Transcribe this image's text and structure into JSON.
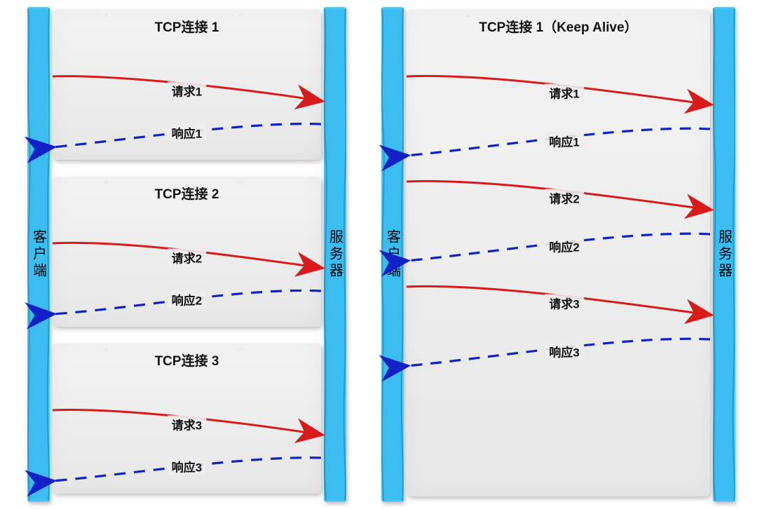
{
  "actors": {
    "client": "客户端",
    "server": "服务器"
  },
  "left": {
    "blocks": [
      {
        "title": "TCP连接 1",
        "req_label": "请求1",
        "resp_label": "响应1"
      },
      {
        "title": "TCP连接 2",
        "req_label": "请求2",
        "resp_label": "响应2"
      },
      {
        "title": "TCP连接 3",
        "req_label": "请求3",
        "resp_label": "响应3"
      }
    ]
  },
  "right": {
    "title": "TCP连接 1（Keep Alive）",
    "exchanges": [
      {
        "req_label": "请求1",
        "resp_label": "响应1"
      },
      {
        "req_label": "请求2",
        "resp_label": "响应2"
      },
      {
        "req_label": "请求3",
        "resp_label": "响应3"
      }
    ]
  },
  "colors": {
    "request": "#d91a1a",
    "response": "#1221c5",
    "bar": "#3cbdf1"
  },
  "chart_data": {
    "type": "sequence-diagram",
    "panels": [
      {
        "mode": "separate-connections",
        "client": "客户端",
        "server": "服务器",
        "connections": [
          {
            "name": "TCP连接 1",
            "messages": [
              {
                "dir": "client->server",
                "label": "请求1",
                "style": "solid",
                "color": "#d91a1a"
              },
              {
                "dir": "server->client",
                "label": "响应1",
                "style": "dashed",
                "color": "#1221c5"
              }
            ]
          },
          {
            "name": "TCP连接 2",
            "messages": [
              {
                "dir": "client->server",
                "label": "请求2",
                "style": "solid",
                "color": "#d91a1a"
              },
              {
                "dir": "server->client",
                "label": "响应2",
                "style": "dashed",
                "color": "#1221c5"
              }
            ]
          },
          {
            "name": "TCP连接 3",
            "messages": [
              {
                "dir": "client->server",
                "label": "请求3",
                "style": "solid",
                "color": "#d91a1a"
              },
              {
                "dir": "server->client",
                "label": "响应3",
                "style": "dashed",
                "color": "#1221c5"
              }
            ]
          }
        ]
      },
      {
        "mode": "keep-alive",
        "client": "客户端",
        "server": "服务器",
        "connections": [
          {
            "name": "TCP连接 1（Keep Alive）",
            "messages": [
              {
                "dir": "client->server",
                "label": "请求1",
                "style": "solid",
                "color": "#d91a1a"
              },
              {
                "dir": "server->client",
                "label": "响应1",
                "style": "dashed",
                "color": "#1221c5"
              },
              {
                "dir": "client->server",
                "label": "请求2",
                "style": "solid",
                "color": "#d91a1a"
              },
              {
                "dir": "server->client",
                "label": "响应2",
                "style": "dashed",
                "color": "#1221c5"
              },
              {
                "dir": "client->server",
                "label": "请求3",
                "style": "solid",
                "color": "#d91a1a"
              },
              {
                "dir": "server->client",
                "label": "响应3",
                "style": "dashed",
                "color": "#1221c5"
              }
            ]
          }
        ]
      }
    ]
  }
}
